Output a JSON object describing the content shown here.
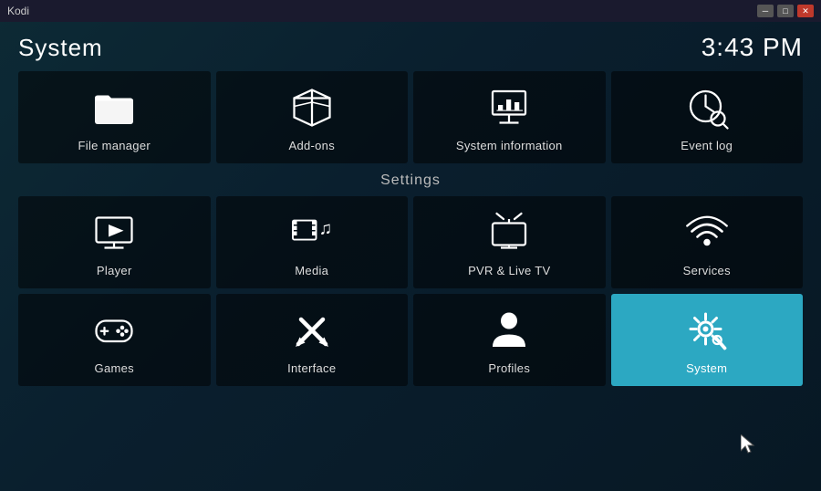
{
  "titlebar": {
    "title": "Kodi",
    "minimize": "─",
    "maximize": "□",
    "close": "✕"
  },
  "header": {
    "app_title": "System",
    "clock": "3:43 PM"
  },
  "top_items": [
    {
      "id": "file-manager",
      "label": "File manager",
      "icon": "folder"
    },
    {
      "id": "add-ons",
      "label": "Add-ons",
      "icon": "addons"
    },
    {
      "id": "system-information",
      "label": "System information",
      "icon": "sysinfo"
    },
    {
      "id": "event-log",
      "label": "Event log",
      "icon": "eventlog"
    }
  ],
  "settings_label": "Settings",
  "settings_row1": [
    {
      "id": "player",
      "label": "Player",
      "icon": "player"
    },
    {
      "id": "media",
      "label": "Media",
      "icon": "media"
    },
    {
      "id": "pvr-live-tv",
      "label": "PVR & Live TV",
      "icon": "pvr"
    },
    {
      "id": "services",
      "label": "Services",
      "icon": "services"
    }
  ],
  "settings_row2": [
    {
      "id": "games",
      "label": "Games",
      "icon": "games"
    },
    {
      "id": "interface",
      "label": "Interface",
      "icon": "interface"
    },
    {
      "id": "profiles",
      "label": "Profiles",
      "icon": "profiles"
    },
    {
      "id": "system",
      "label": "System",
      "icon": "system",
      "active": true
    }
  ]
}
